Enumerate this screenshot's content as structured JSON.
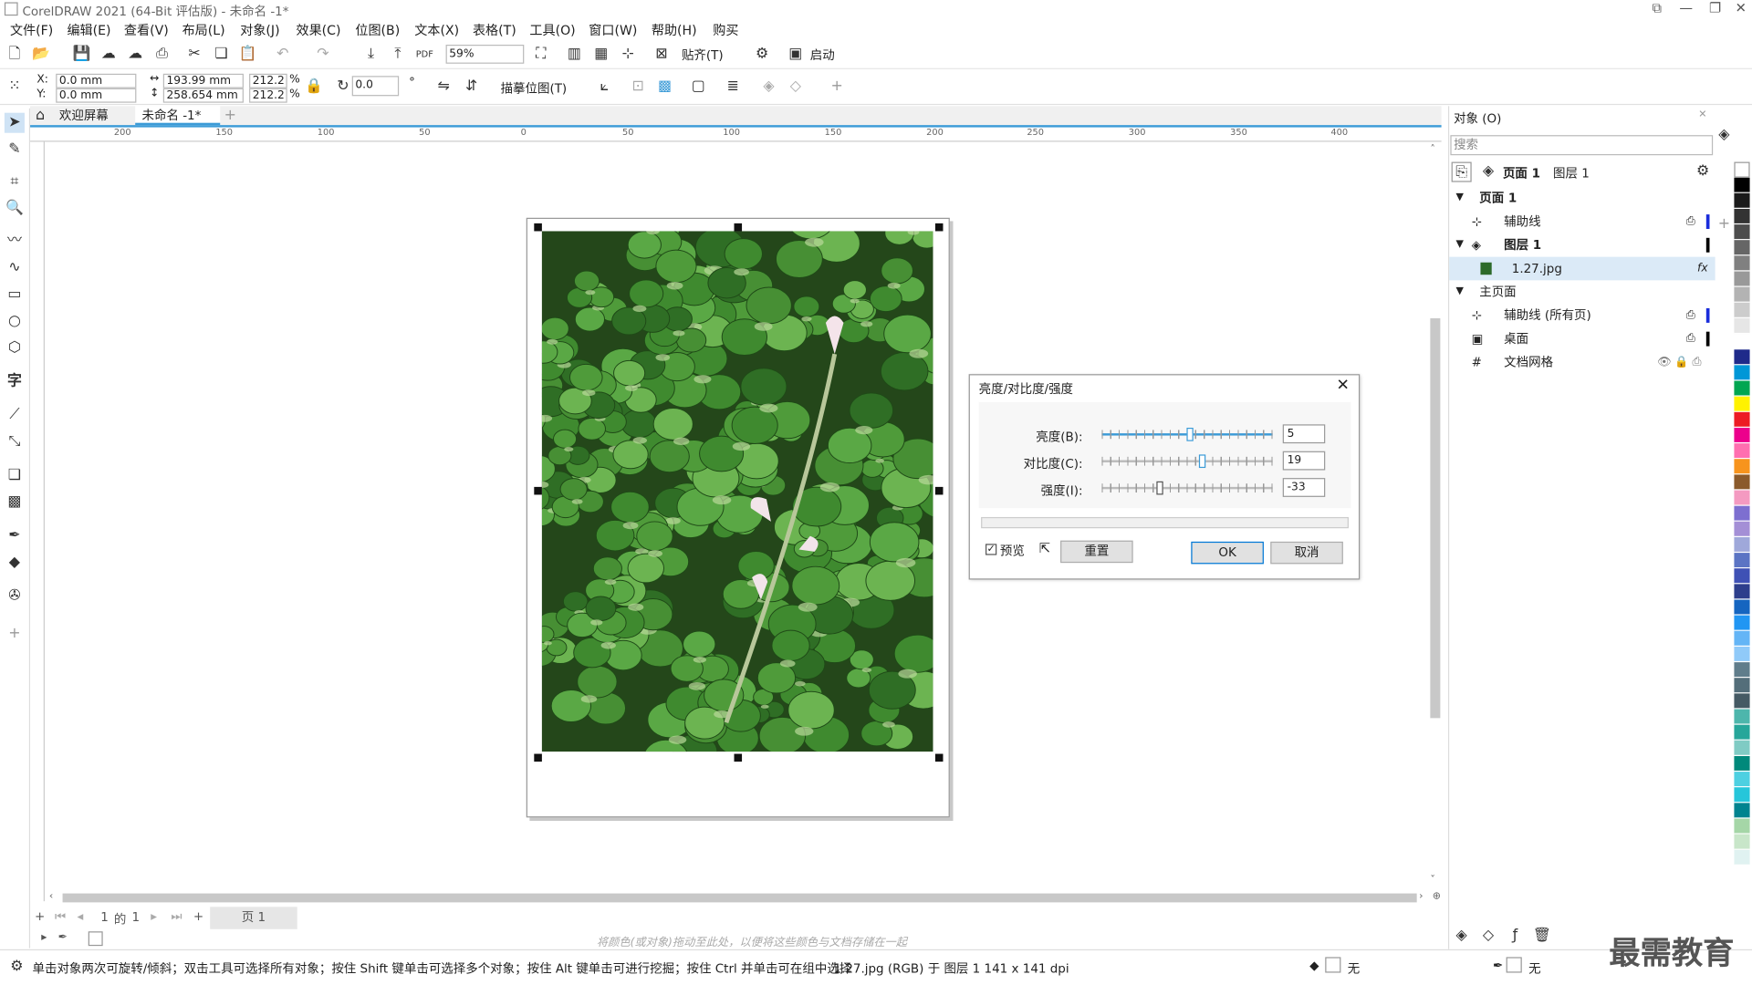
{
  "window": {
    "title": "CorelDRAW 2021 (64-Bit 评估版) - 未命名 -1*"
  },
  "menu": [
    "文件(F)",
    "编辑(E)",
    "查看(V)",
    "布局(L)",
    "对象(J)",
    "效果(C)",
    "位图(B)",
    "文本(X)",
    "表格(T)",
    "工具(O)",
    "窗口(W)",
    "帮助(H)",
    "购买"
  ],
  "toolbar": {
    "zoom": "59%",
    "snap_label": "贴齐(T)",
    "launch_label": "启动"
  },
  "props": {
    "x": "0.0 mm",
    "y": "0.0 mm",
    "width": "193.99 mm",
    "height": "258.654 mm",
    "scale_w": "212.2",
    "scale_h": "212.2",
    "pct": "%",
    "angle": "0.0",
    "trace_label": "描摹位图(T)"
  },
  "tabs": {
    "welcome": "欢迎屏幕",
    "doc": "未命名 -1*"
  },
  "ruler": [
    "200",
    "150",
    "100",
    "50",
    "0",
    "50",
    "100",
    "150",
    "200",
    "250",
    "300",
    "350",
    "400"
  ],
  "dialog": {
    "title": "亮度/对比度/强度",
    "brightness_label": "亮度(B):",
    "brightness": "5",
    "brightness_pct": 0.52,
    "contrast_label": "对比度(C):",
    "contrast": "19",
    "contrast_pct": 0.59,
    "intensity_label": "强度(I):",
    "intensity": "-33",
    "intensity_pct": 0.33,
    "preview": "预览",
    "reset": "重置",
    "ok": "OK",
    "cancel": "取消"
  },
  "pagenav": {
    "current": "1",
    "of": "的",
    "total": "1",
    "page_tab": "页 1"
  },
  "colorbar_hint": "将颜色(或对象)拖动至此处，以便将这些颜色与文档存储在一起",
  "status": {
    "hint": "单击对象两次可旋转/倾斜；双击工具可选择所有对象；按住 Shift 键单击可选择多个对象；按住 Alt 键单击可进行挖掘；按住 Ctrl 并单击可在组中选择",
    "info": "1.27.jpg (RGB) 于 图层 1 141 x 141 dpi",
    "fill": "无",
    "outline": "无"
  },
  "panel": {
    "title": "对象 (O)",
    "search_placeholder": "搜索",
    "page": "页面 1",
    "layer": "图层 1",
    "tree": [
      {
        "label": "页面 1",
        "level": 0
      },
      {
        "label": "辅助线",
        "level": 1
      },
      {
        "label": "图层 1",
        "level": 1
      },
      {
        "label": "1.27.jpg",
        "level": 2
      },
      {
        "label": "主页面",
        "level": 0
      },
      {
        "label": "辅助线 (所有页)",
        "level": 1
      },
      {
        "label": "桌面",
        "level": 1
      },
      {
        "label": "文档网格",
        "level": 1
      }
    ]
  },
  "palette": [
    "#000000",
    "#1a1a1a",
    "#333333",
    "#4d4d4d",
    "#666666",
    "#808080",
    "#999999",
    "#b3b3b3",
    "#cccccc",
    "#e6e6e6",
    "#ffffff",
    "#1f2a8a",
    "#0097d7",
    "#00a651",
    "#fff200",
    "#ed1c24",
    "#ec008c",
    "#ff6fb0",
    "#f7941d",
    "#8b5a2b",
    "#f49ac1",
    "#7d6fd0",
    "#a48fd6",
    "#9fa8da",
    "#5b74c4",
    "#3f51b5",
    "#2d3e8c",
    "#1565c0",
    "#2196f3",
    "#64b5f6",
    "#90caf9",
    "#607d8b",
    "#546e7a",
    "#455a64",
    "#4db6ac",
    "#26a69a",
    "#80cbc4",
    "#00897b",
    "#4dd0e1",
    "#26c6da",
    "#00838f",
    "#a5d6a7",
    "#c8e6c9",
    "#e0f2f1"
  ],
  "watermark": "最需教育"
}
